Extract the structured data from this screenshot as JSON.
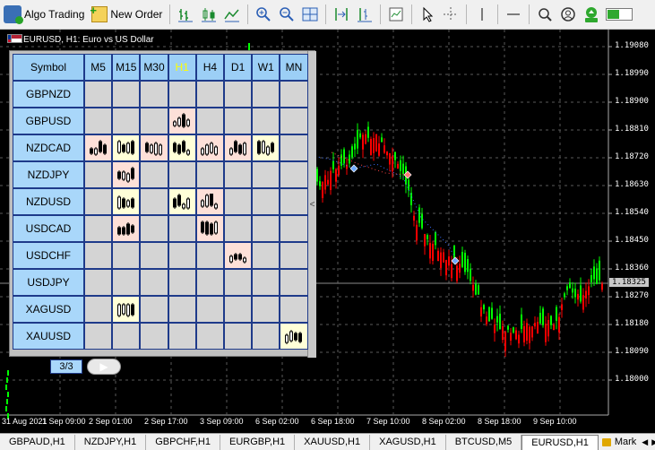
{
  "toolbar": {
    "algo_trading_label": "Algo Trading",
    "new_order_label": "New Order"
  },
  "chart": {
    "title": "EURUSD, H1:  Euro vs US Dollar",
    "price_labels": [
      "1.19080",
      "1.18990",
      "1.18900",
      "1.18810",
      "1.18720",
      "1.18630",
      "1.18540",
      "1.18450",
      "1.18360",
      "1.18270",
      "1.18180",
      "1.18090",
      "1.18000"
    ],
    "current_price": "1.18325",
    "time_labels": [
      "31 Aug 2021",
      "1 Sep 09:00",
      "2 Sep 01:00",
      "2 Sep 17:00",
      "3 Sep 09:00",
      "6 Sep 02:00",
      "6 Sep 18:00",
      "7 Sep 10:00",
      "8 Sep 02:00",
      "8 Sep 18:00",
      "9 Sep 10:00"
    ],
    "colors": {
      "bull": "#00ff00",
      "bear": "#ff0000",
      "background": "#000000",
      "grid": "#5a5a5a"
    }
  },
  "panel": {
    "symbol_header": "Symbol",
    "timeframes": [
      "M5",
      "M15",
      "M30",
      "H1",
      "H4",
      "D1",
      "W1",
      "MN"
    ],
    "active_timeframe": "H1",
    "symbols": [
      "GBPNZD",
      "GBPUSD",
      "NZDCAD",
      "NZDJPY",
      "NZDUSD",
      "USDCAD",
      "USDCHF",
      "USDJPY",
      "XAGUSD",
      "XAUUSD"
    ],
    "page_indicator": "3/3",
    "edge_arrow": "<"
  },
  "tabs": [
    "GBPAUD,H1",
    "NZDJPY,H1",
    "GBPCHF,H1",
    "EURGBP,H1",
    "XAUUSD,H1",
    "XAGUSD,H1",
    "BTCUSD,M5",
    "EURUSD,H1"
  ],
  "active_tab": "EURUSD,H1",
  "tab_more_label": "Mark"
}
